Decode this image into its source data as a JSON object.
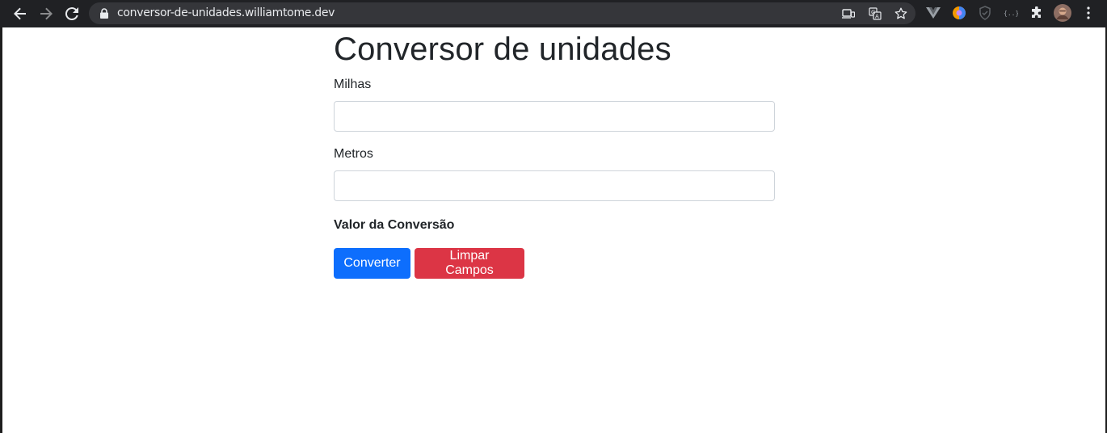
{
  "browser": {
    "url": "conversor-de-unidades.williamtome.dev"
  },
  "page": {
    "title": "Conversor de unidades",
    "fields": [
      {
        "label": "Milhas",
        "value": ""
      },
      {
        "label": "Metros",
        "value": ""
      }
    ],
    "result_label": "Valor da Conversão",
    "convert_button": "Converter",
    "clear_button": "Limpar Campos"
  },
  "colors": {
    "primary": "#0d6efd",
    "danger": "#dc3545",
    "text": "#212529",
    "chrome": "#202124"
  },
  "icons": [
    "back-icon",
    "forward-icon",
    "reload-icon",
    "lock-icon",
    "cast-icon",
    "translate-icon",
    "bookmark-star-icon",
    "extension-icons",
    "puzzle-icon",
    "profile-avatar",
    "menu-icon"
  ]
}
